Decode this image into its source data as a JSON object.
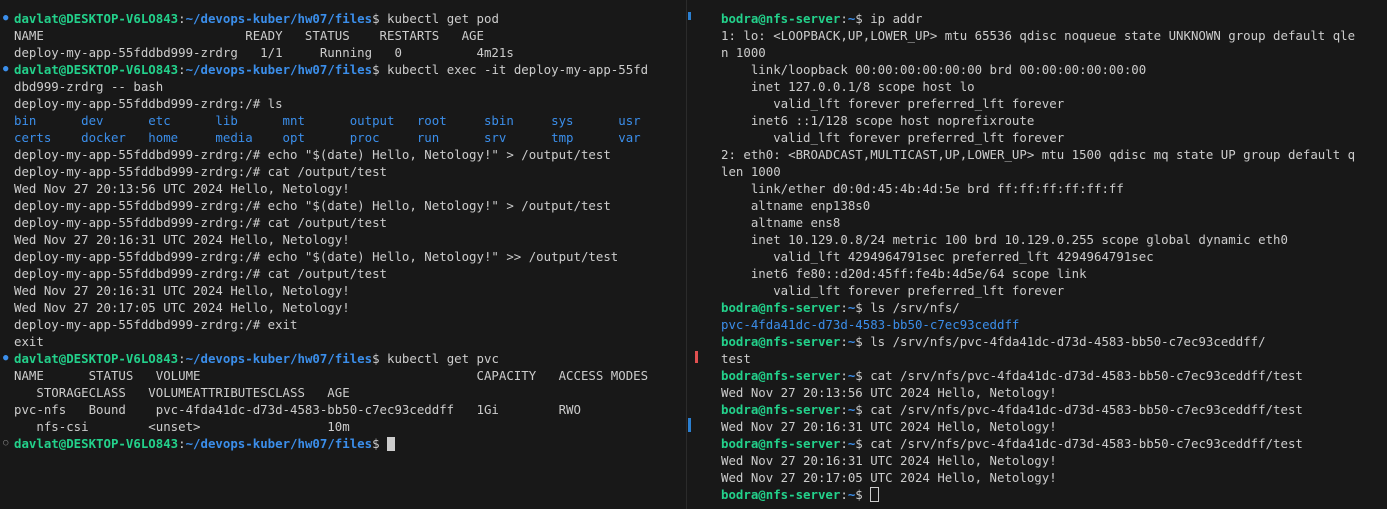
{
  "colors": {
    "background": "#181818",
    "text": "#cccccc",
    "prompt_user": "#23d18b",
    "prompt_path": "#3b8eea",
    "scroll_mark_blue": "#2b7fd0",
    "scroll_mark_red": "#e05050"
  },
  "left": {
    "prompt_user": "davlat@DESKTOP-V6LO843",
    "prompt_path": "~/devops-kuber/hw07/files",
    "lines": [
      {
        "type": "prompt",
        "cmd": "kubectl get pod"
      },
      {
        "type": "text",
        "text": "NAME                           READY   STATUS    RESTARTS   AGE"
      },
      {
        "type": "text",
        "text": "deploy-my-app-55fddbd999-zrdrg   1/1     Running   0          4m21s"
      },
      {
        "type": "prompt",
        "cmd": "kubectl exec -it deploy-my-app-55fd"
      },
      {
        "type": "text",
        "text": "dbd999-zrdrg -- bash"
      },
      {
        "type": "text",
        "text": "deploy-my-app-55fddbd999-zrdrg:/# ls"
      },
      {
        "type": "text",
        "text": "bin      dev      etc      lib      mnt      output   root     sbin     sys      usr",
        "blue": true
      },
      {
        "type": "text",
        "text": "certs    docker   home     media    opt      proc     run      srv      tmp      var",
        "blue": true
      },
      {
        "type": "text",
        "text": "deploy-my-app-55fddbd999-zrdrg:/# echo \"$(date) Hello, Netology!\" > /output/test"
      },
      {
        "type": "text",
        "text": "deploy-my-app-55fddbd999-zrdrg:/# cat /output/test"
      },
      {
        "type": "text",
        "text": "Wed Nov 27 20:13:56 UTC 2024 Hello, Netology!"
      },
      {
        "type": "text",
        "text": "deploy-my-app-55fddbd999-zrdrg:/# echo \"$(date) Hello, Netology!\" > /output/test"
      },
      {
        "type": "text",
        "text": "deploy-my-app-55fddbd999-zrdrg:/# cat /output/test"
      },
      {
        "type": "text",
        "text": "Wed Nov 27 20:16:31 UTC 2024 Hello, Netology!"
      },
      {
        "type": "text",
        "text": "deploy-my-app-55fddbd999-zrdrg:/# echo \"$(date) Hello, Netology!\" >> /output/test"
      },
      {
        "type": "text",
        "text": "deploy-my-app-55fddbd999-zrdrg:/# cat /output/test"
      },
      {
        "type": "text",
        "text": "Wed Nov 27 20:16:31 UTC 2024 Hello, Netology!"
      },
      {
        "type": "text",
        "text": "Wed Nov 27 20:17:05 UTC 2024 Hello, Netology!"
      },
      {
        "type": "text",
        "text": "deploy-my-app-55fddbd999-zrdrg:/# exit"
      },
      {
        "type": "text",
        "text": "exit"
      },
      {
        "type": "prompt",
        "cmd": "kubectl get pvc"
      },
      {
        "type": "text",
        "text": "NAME      STATUS   VOLUME                                     CAPACITY   ACCESS MODES"
      },
      {
        "type": "text",
        "text": "   STORAGECLASS   VOLUMEATTRIBUTESCLASS   AGE"
      },
      {
        "type": "text",
        "text": "pvc-nfs   Bound    pvc-4fda41dc-d73d-4583-bb50-c7ec93ceddff   1Gi        RWO"
      },
      {
        "type": "text",
        "text": "   nfs-csi        <unset>                 10m"
      },
      {
        "type": "prompt",
        "cmd": "",
        "cursor": true
      }
    ]
  },
  "right": {
    "prompt_user": "bodra@nfs-server",
    "prompt_path": "~",
    "lines": [
      {
        "type": "prompt",
        "cmd": "ip addr"
      },
      {
        "type": "text",
        "text": "1: lo: <LOOPBACK,UP,LOWER_UP> mtu 65536 qdisc noqueue state UNKNOWN group default qle"
      },
      {
        "type": "text",
        "text": "n 1000"
      },
      {
        "type": "text",
        "text": "    link/loopback 00:00:00:00:00:00 brd 00:00:00:00:00:00"
      },
      {
        "type": "text",
        "text": "    inet 127.0.0.1/8 scope host lo"
      },
      {
        "type": "text",
        "text": "       valid_lft forever preferred_lft forever"
      },
      {
        "type": "text",
        "text": "    inet6 ::1/128 scope host noprefixroute"
      },
      {
        "type": "text",
        "text": "       valid_lft forever preferred_lft forever"
      },
      {
        "type": "text",
        "text": "2: eth0: <BROADCAST,MULTICAST,UP,LOWER_UP> mtu 1500 qdisc mq state UP group default q"
      },
      {
        "type": "text",
        "text": "len 1000"
      },
      {
        "type": "text",
        "text": "    link/ether d0:0d:45:4b:4d:5e brd ff:ff:ff:ff:ff:ff"
      },
      {
        "type": "text",
        "text": "    altname enp138s0"
      },
      {
        "type": "text",
        "text": "    altname ens8"
      },
      {
        "type": "text",
        "text": "    inet 10.129.0.8/24 metric 100 brd 10.129.0.255 scope global dynamic eth0"
      },
      {
        "type": "text",
        "text": "       valid_lft 4294964791sec preferred_lft 4294964791sec"
      },
      {
        "type": "text",
        "text": "    inet6 fe80::d20d:45ff:fe4b:4d5e/64 scope link"
      },
      {
        "type": "text",
        "text": "       valid_lft forever preferred_lft forever"
      },
      {
        "type": "prompt",
        "cmd": "ls /srv/nfs/"
      },
      {
        "type": "text",
        "text": "pvc-4fda41dc-d73d-4583-bb50-c7ec93ceddff",
        "blue": true
      },
      {
        "type": "prompt",
        "cmd": "ls /srv/nfs/pvc-4fda41dc-d73d-4583-bb50-c7ec93ceddff/"
      },
      {
        "type": "text",
        "text": "test"
      },
      {
        "type": "prompt",
        "cmd": "cat /srv/nfs/pvc-4fda41dc-d73d-4583-bb50-c7ec93ceddff/test"
      },
      {
        "type": "text",
        "text": "Wed Nov 27 20:13:56 UTC 2024 Hello, Netology!"
      },
      {
        "type": "prompt",
        "cmd": "cat /srv/nfs/pvc-4fda41dc-d73d-4583-bb50-c7ec93ceddff/test"
      },
      {
        "type": "text",
        "text": "Wed Nov 27 20:16:31 UTC 2024 Hello, Netology!"
      },
      {
        "type": "prompt",
        "cmd": "cat /srv/nfs/pvc-4fda41dc-d73d-4583-bb50-c7ec93ceddff/test"
      },
      {
        "type": "text",
        "text": "Wed Nov 27 20:16:31 UTC 2024 Hello, Netology!"
      },
      {
        "type": "text",
        "text": "Wed Nov 27 20:17:05 UTC 2024 Hello, Netology!"
      },
      {
        "type": "prompt",
        "cmd": "",
        "cursor": true
      }
    ]
  }
}
